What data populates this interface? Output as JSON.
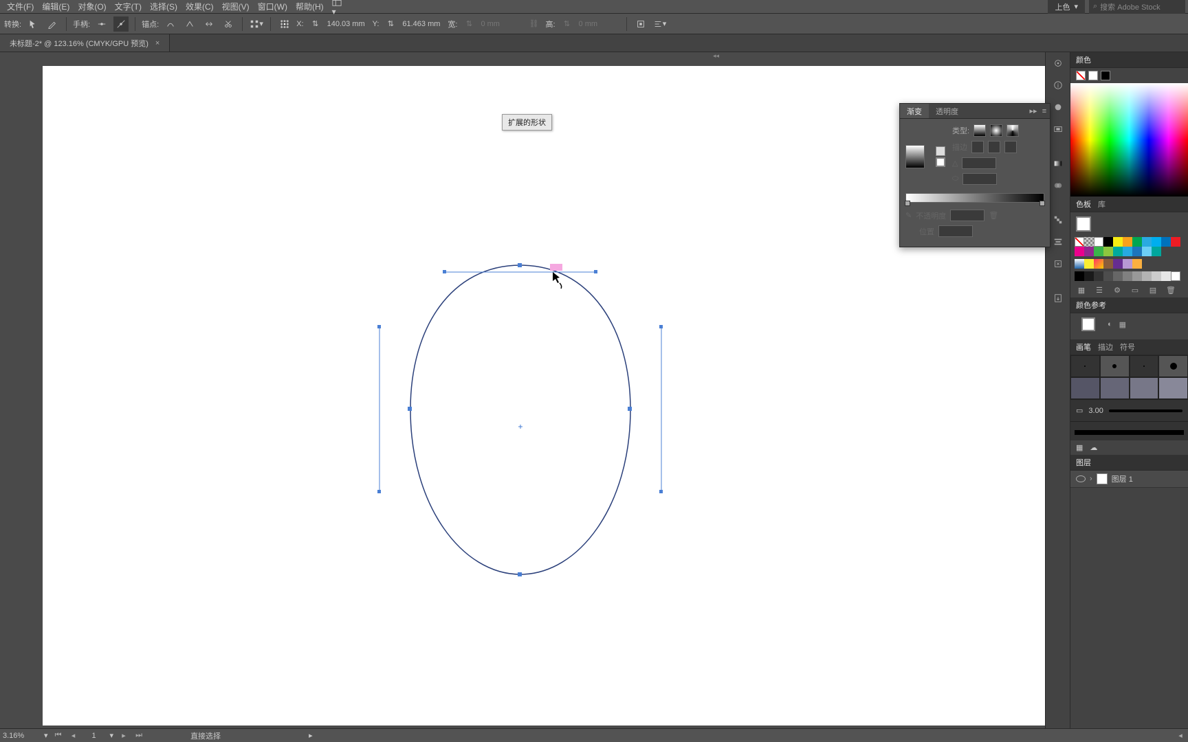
{
  "menu": {
    "items": [
      "文件(F)",
      "编辑(E)",
      "对象(O)",
      "文字(T)",
      "选择(S)",
      "效果(C)",
      "视图(V)",
      "窗口(W)",
      "帮助(H)"
    ],
    "workspace": "上色",
    "search_placeholder": "搜索 Adobe Stock"
  },
  "options": {
    "label_transform": "转换:",
    "label_handles": "手柄:",
    "label_anchor": "锚点:",
    "x_label": "X:",
    "x_value": "140.03 mm",
    "y_label": "Y:",
    "y_value": "61.463 mm",
    "w_label": "宽:",
    "w_value": "0 mm",
    "h_label": "高:",
    "h_value": "0 mm"
  },
  "tab": {
    "title": "未标题-2* @ 123.16% (CMYK/GPU 预览)"
  },
  "tooltip": {
    "text": "扩展的形状"
  },
  "gradient": {
    "tab1": "渐变",
    "tab2": "透明度",
    "type_label": "类型:",
    "stroke_label": "描边",
    "angle": "",
    "aspect": "",
    "opacity_label": "不透明度",
    "position_label": "位置"
  },
  "panels": {
    "color_title": "颜色",
    "swatches_tabs": [
      "色板",
      "库"
    ],
    "color_guide_title": "颜色参考",
    "brush_tabs": [
      "画笔",
      "描边",
      "符号"
    ],
    "brush_size": "3.00",
    "layers_title": "图层",
    "layer_name": "图层 1"
  },
  "status": {
    "zoom": "3.16%",
    "page": "1",
    "tool": "直接选择"
  },
  "chart_data": {
    "type": "other"
  }
}
